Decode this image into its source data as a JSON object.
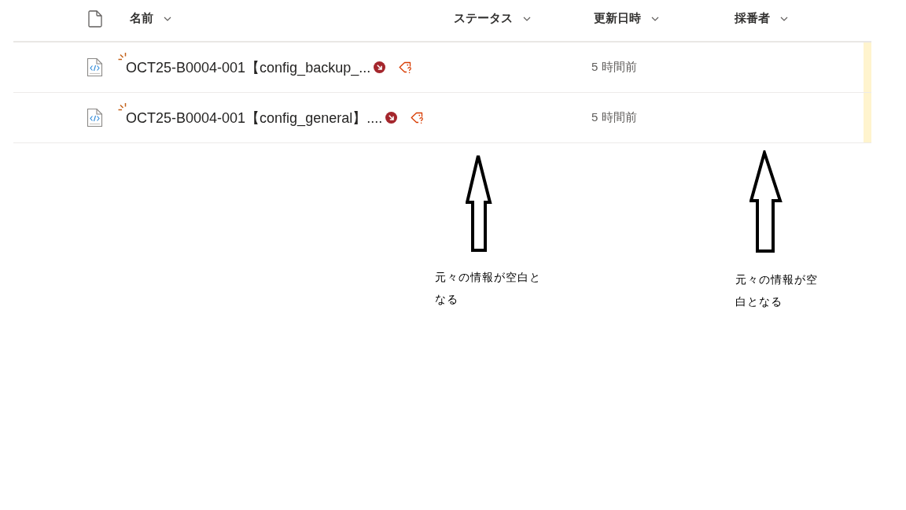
{
  "table": {
    "columns": [
      {
        "label": "名前"
      },
      {
        "label": "ステータス"
      },
      {
        "label": "更新日時"
      },
      {
        "label": "採番者"
      }
    ],
    "rows": [
      {
        "name": "OCT25-B0004-001【config_backup_...",
        "new": true,
        "missing_info": true,
        "modified": "5 時間前",
        "highlighted": true
      },
      {
        "name": "OCT25-B0004-001【config_general】....",
        "new": true,
        "missing_info": true,
        "modified": "5 時間前",
        "highlighted": true
      }
    ]
  },
  "annotations": [
    {
      "text": "元々の情報が空白となる"
    },
    {
      "text": "元々の情報が空白となる"
    }
  ]
}
